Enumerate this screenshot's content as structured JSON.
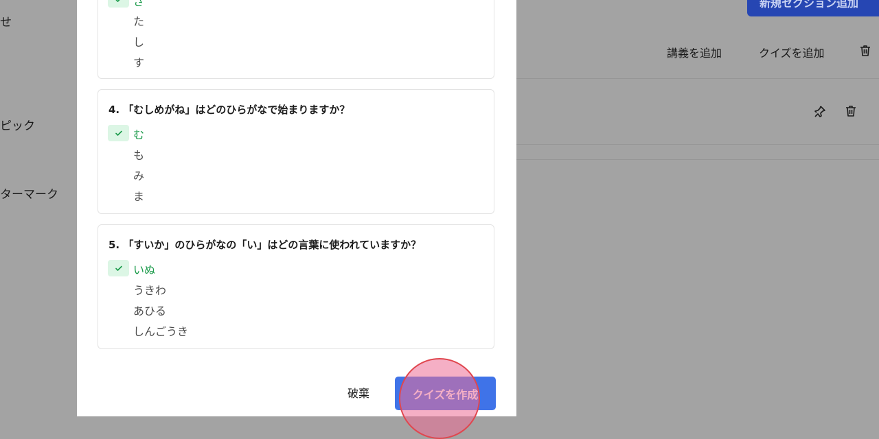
{
  "background": {
    "sidebar_items": [
      "せ",
      "ピック",
      "ターマーク"
    ],
    "header_button_label": "新規セクション追加",
    "actions": {
      "add_lecture": "講義を追加",
      "add_quiz": "クイズを追加"
    }
  },
  "modal": {
    "question3": {
      "options": [
        "さ",
        "た",
        "し",
        "す"
      ]
    },
    "question4": {
      "title": "4. 「むしめがね」はどのひらがなで始まりますか？",
      "options": [
        "む",
        "も",
        "み",
        "ま"
      ]
    },
    "question5": {
      "title": "5. 「すいか」のひらがなの「い」はどの言葉に使われていますか？",
      "options": [
        "いぬ",
        "うきわ",
        "あひる",
        "しんごうき"
      ]
    },
    "discard_label": "破棄",
    "create_label": "クイズを作成"
  },
  "colors": {
    "accent": "#3f73e8",
    "correct": "#1a9a4a",
    "overlay": "#a3a3a3"
  }
}
